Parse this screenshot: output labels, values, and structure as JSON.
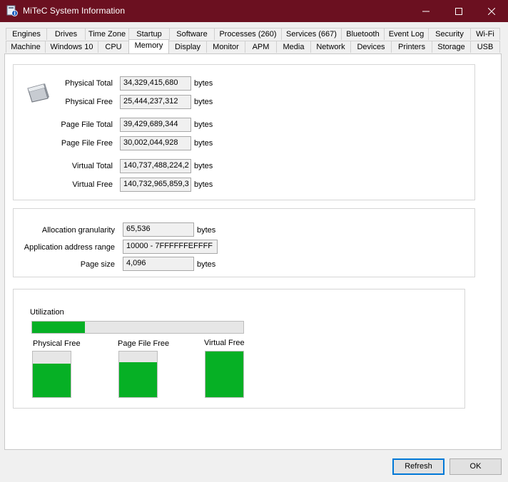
{
  "window": {
    "title": "MiTeC System Information"
  },
  "tabs_row1": [
    "Engines",
    "Drives",
    "Time Zone",
    "Startup",
    "Software",
    "Processes (260)",
    "Services (667)",
    "Bluetooth",
    "Event Log",
    "Security",
    "Wi-Fi"
  ],
  "tabs_row2": [
    "Machine",
    "Windows 10",
    "CPU",
    "Memory",
    "Display",
    "Monitor",
    "APM",
    "Media",
    "Network",
    "Devices",
    "Printers",
    "Storage",
    "USB"
  ],
  "active_tab": "Memory",
  "memory": {
    "unit": "bytes",
    "rows": [
      {
        "label": "Physical Total",
        "value": "34,329,415,680"
      },
      {
        "label": "Physical Free",
        "value": "25,444,237,312"
      },
      {
        "label": "Page File Total",
        "value": "39,429,689,344"
      },
      {
        "label": "Page File Free",
        "value": "30,002,044,928"
      },
      {
        "label": "Virtual Total",
        "value": "140,737,488,224,2"
      },
      {
        "label": "Virtual Free",
        "value": "140,732,965,859,3"
      }
    ]
  },
  "system": {
    "allocation_label": "Allocation granularity",
    "allocation_value": "65,536",
    "allocation_unit": "bytes",
    "address_label": "Application address range",
    "address_value": "10000 - 7FFFFFFEFFFF",
    "pagesize_label": "Page size",
    "pagesize_value": "4,096",
    "pagesize_unit": "bytes"
  },
  "utilization": {
    "label": "Utilization",
    "value": 0.25,
    "bars": [
      {
        "label": "Physical Free",
        "value": 0.74
      },
      {
        "label": "Page File Free",
        "value": 0.76
      },
      {
        "label": "Virtual Free",
        "value": 1.0
      }
    ]
  },
  "buttons": {
    "refresh": "Refresh",
    "ok": "OK"
  },
  "colors": {
    "titlebar": "#6b1020",
    "bar_fill": "#06b025",
    "bar_bg": "#e6e6e6",
    "default_button_border": "#0078d7"
  }
}
